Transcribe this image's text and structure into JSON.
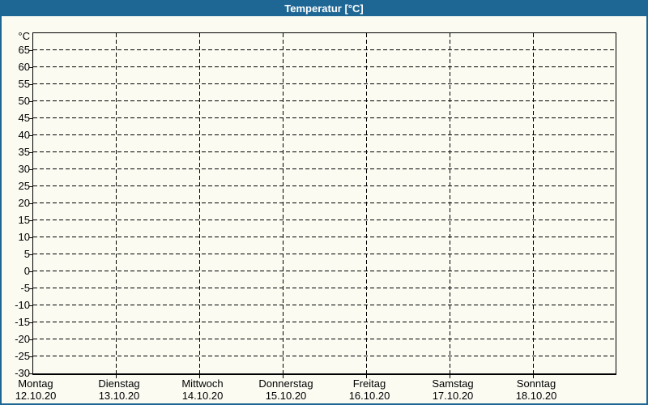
{
  "title": "Temperatur [°C]",
  "colors": {
    "frame_blue": "#1e6795",
    "panel_background": "#fbfbf2",
    "title_text": "#ffffff",
    "axis_ink": "#000000"
  },
  "chart_data": {
    "type": "line",
    "title": "Temperatur [°C]",
    "y_unit_label": "°C",
    "ylim": [
      -30,
      70
    ],
    "y_tick_step": 5,
    "y_ticks": [
      65,
      60,
      55,
      50,
      45,
      40,
      35,
      30,
      25,
      20,
      15,
      10,
      5,
      0,
      -5,
      -10,
      -15,
      -20,
      -25,
      -30
    ],
    "categories": [
      "Montag",
      "Dienstag",
      "Mittwoch",
      "Donnerstag",
      "Freitag",
      "Samstag",
      "Sonntag"
    ],
    "category_dates": [
      "12.10.20",
      "13.10.20",
      "14.10.20",
      "15.10.20",
      "16.10.20",
      "17.10.20",
      "18.10.20"
    ],
    "grid": true,
    "grid_style": "dashed",
    "legend": false,
    "series": []
  }
}
